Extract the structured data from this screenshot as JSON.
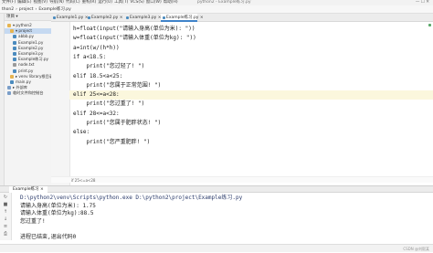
{
  "window": {
    "menu": [
      "文件(F)",
      "编辑(E)",
      "视图(V)",
      "导航(N)",
      "代码(C)",
      "重构(R)",
      "运行(U)",
      "工具(T)",
      "VCS(S)",
      "窗口(W)",
      "帮助(H)"
    ],
    "title": "python2 - Example练习.py",
    "controls": "—  ☐  ✕"
  },
  "navbar": {
    "crumbs": [
      "thon2",
      "project",
      "Example练习.py"
    ]
  },
  "project_panel": {
    "header": "项目 ▾",
    "tree": [
      {
        "label": "▾ python2",
        "icon": "folder-icon",
        "indent": 1
      },
      {
        "label": "▾ project",
        "icon": "folder-icon",
        "indent": 2,
        "selected": true
      },
      {
        "label": "abbb.py",
        "icon": "python-file-icon",
        "indent": 3
      },
      {
        "label": "Example1.py",
        "icon": "python-file-icon",
        "indent": 3
      },
      {
        "label": "Example2.py",
        "icon": "python-file-icon",
        "indent": 3
      },
      {
        "label": "Example3.py",
        "icon": "python-file-icon",
        "indent": 3
      },
      {
        "label": "Example练习.py",
        "icon": "python-file-icon",
        "indent": 3
      },
      {
        "label": "node.txt",
        "icon": "text-file-icon",
        "indent": 3
      },
      {
        "label": "print.py",
        "icon": "python-file-icon",
        "indent": 3
      },
      {
        "label": "▸ venv  library根目录",
        "icon": "folder-icon",
        "indent": 2
      },
      {
        "label": "main.py",
        "icon": "python-file-icon",
        "indent": 2
      },
      {
        "label": "▸ 外部库",
        "icon": "library-icon",
        "indent": 1
      },
      {
        "label": "临时文件和控制台",
        "icon": "console-icon",
        "indent": 1
      }
    ]
  },
  "tabs": [
    {
      "label": "Example1.py ×",
      "active": false
    },
    {
      "label": "Example2.py ×",
      "active": false
    },
    {
      "label": "Example3.py ×",
      "active": false
    },
    {
      "label": "Example练习.py ×",
      "active": true
    }
  ],
  "code": [
    {
      "text": "h=float(input(\"请输入身高(单位为米): \"))"
    },
    {
      "text": "w=float(input(\"请输入体重(单位为kg): \"))"
    },
    {
      "text": "a=int(w/(h*h))"
    },
    {
      "text": "if a<18.5:"
    },
    {
      "text": "    print(\"您过轻了! \")"
    },
    {
      "text": "elif 18.5<a<25:"
    },
    {
      "text": "    print(\"您属于正常范围! \")"
    },
    {
      "text": "elif 25<=a<28:",
      "highlight": true
    },
    {
      "text": "    print(\"您过重了! \")"
    },
    {
      "text": "elif 28<=a<32:"
    },
    {
      "text": "    print(\"您属于肥胖状态! \")"
    },
    {
      "text": "else:"
    },
    {
      "text": "    print(\"您严重肥胖! \")"
    }
  ],
  "breadcrumb": "if 25<=a<28",
  "run": {
    "tab_label": "Example练习 ×",
    "output": [
      {
        "text": "D:\\python2\\venv\\Scripts\\python.exe D:\\python2\\project\\Example练习.py",
        "kind": "cmd"
      },
      {
        "text": "请输入身高(单位为米): 1.75",
        "kind": "io"
      },
      {
        "text": "请输入体重(单位为kg):88.5",
        "kind": "io"
      },
      {
        "text": "您过重了!",
        "kind": "plain"
      },
      {
        "text": "",
        "kind": "plain"
      },
      {
        "text": "进程已结束,退出代码0",
        "kind": "plain"
      }
    ]
  },
  "watermark": "CSDN @刘毅某"
}
